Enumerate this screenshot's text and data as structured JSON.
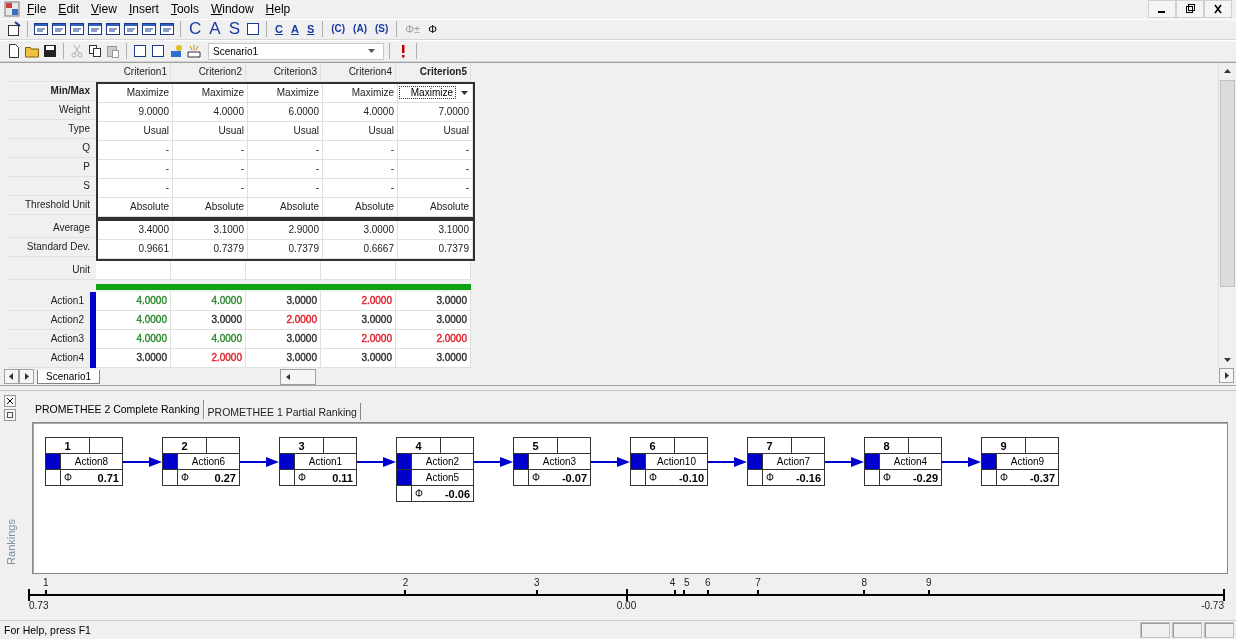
{
  "menu": [
    "File",
    "Edit",
    "View",
    "Insert",
    "Tools",
    "Window",
    "Help"
  ],
  "toolbar_letters": {
    "large": [
      "C",
      "A",
      "S"
    ],
    "underlined": [
      "C",
      "A",
      "S"
    ],
    "bracketed": [
      "(C)",
      "(A)",
      "(S)"
    ],
    "phi": [
      {
        "text": "Φ±",
        "disabled": true
      },
      {
        "text": "Φ",
        "disabled": false
      }
    ]
  },
  "scenario_select": {
    "value": "Scenario1"
  },
  "table": {
    "columns": [
      {
        "name": "Criterion1",
        "selected": false
      },
      {
        "name": "Criterion2",
        "selected": false
      },
      {
        "name": "Criterion3",
        "selected": false
      },
      {
        "name": "Criterion4",
        "selected": false
      },
      {
        "name": "Criterion5",
        "selected": true
      }
    ],
    "parameters": [
      {
        "label": "Min/Max",
        "selected": true,
        "cells": [
          "Maximize",
          "Maximize",
          "Maximize",
          "Maximize",
          "Maximize"
        ]
      },
      {
        "label": "Weight",
        "selected": false,
        "cells": [
          "9.0000",
          "4.0000",
          "6.0000",
          "4.0000",
          "7.0000"
        ]
      },
      {
        "label": "Type",
        "selected": false,
        "cells": [
          "Usual",
          "Usual",
          "Usual",
          "Usual",
          "Usual"
        ]
      },
      {
        "label": "Q",
        "selected": false,
        "cells": [
          "-",
          "-",
          "-",
          "-",
          "-"
        ]
      },
      {
        "label": "P",
        "selected": false,
        "cells": [
          "-",
          "-",
          "-",
          "-",
          "-"
        ]
      },
      {
        "label": "S",
        "selected": false,
        "cells": [
          "-",
          "-",
          "-",
          "-",
          "-"
        ]
      },
      {
        "label": "Threshold Unit",
        "selected": false,
        "cells": [
          "Absolute",
          "Absolute",
          "Absolute",
          "Absolute",
          "Absolute"
        ]
      }
    ],
    "statistics": [
      {
        "label": "Average",
        "cells": [
          "3.4000",
          "3.1000",
          "2.9000",
          "3.0000",
          "3.1000"
        ]
      },
      {
        "label": "Standard Dev.",
        "cells": [
          "0.9661",
          "0.7379",
          "0.7379",
          "0.6667",
          "0.7379"
        ]
      }
    ],
    "unit_row": {
      "label": "Unit"
    },
    "actions": [
      {
        "label": "Action1",
        "color": "#0000cc",
        "cells": [
          {
            "value": "4.0000",
            "color": "#2e8b2e"
          },
          {
            "value": "4.0000",
            "color": "#2e8b2e"
          },
          {
            "value": "3.0000",
            "color": "#333333"
          },
          {
            "value": "2.0000",
            "color": "#e0202c"
          },
          {
            "value": "3.0000",
            "color": "#333333"
          }
        ]
      },
      {
        "label": "Action2",
        "color": "#0000cc",
        "cells": [
          {
            "value": "4.0000",
            "color": "#2e8b2e"
          },
          {
            "value": "3.0000",
            "color": "#333333"
          },
          {
            "value": "2.0000",
            "color": "#e0202c"
          },
          {
            "value": "3.0000",
            "color": "#333333"
          },
          {
            "value": "3.0000",
            "color": "#333333"
          }
        ]
      },
      {
        "label": "Action3",
        "color": "#0000cc",
        "cells": [
          {
            "value": "4.0000",
            "color": "#2e8b2e"
          },
          {
            "value": "4.0000",
            "color": "#2e8b2e"
          },
          {
            "value": "3.0000",
            "color": "#333333"
          },
          {
            "value": "2.0000",
            "color": "#e0202c"
          },
          {
            "value": "2.0000",
            "color": "#e0202c"
          }
        ]
      },
      {
        "label": "Action4",
        "color": "#0000cc",
        "cells": [
          {
            "value": "3.0000",
            "color": "#333333"
          },
          {
            "value": "2.0000",
            "color": "#e0202c"
          },
          {
            "value": "3.0000",
            "color": "#333333"
          },
          {
            "value": "3.0000",
            "color": "#333333"
          },
          {
            "value": "3.0000",
            "color": "#333333"
          }
        ]
      }
    ]
  },
  "sheet_tabs": [
    {
      "label": "Scenario1",
      "selected": true
    }
  ],
  "ranking_tabs": [
    {
      "label": "PROMETHEE 2 Complete Ranking",
      "selected": true
    },
    {
      "label": "PROMETHEE 1 Partial Ranking",
      "selected": false
    }
  ],
  "ranking": [
    {
      "rank": "1",
      "actions": [
        "Action8"
      ],
      "symbol": "Φ",
      "phi": "0.71"
    },
    {
      "rank": "2",
      "actions": [
        "Action6"
      ],
      "symbol": "Φ",
      "phi": "0.27"
    },
    {
      "rank": "3",
      "actions": [
        "Action1"
      ],
      "symbol": "Φ",
      "phi": "0.11"
    },
    {
      "rank": "4",
      "actions": [
        "Action2",
        "Action5"
      ],
      "symbol": "Φ",
      "phi": "-0.06"
    },
    {
      "rank": "5",
      "actions": [
        "Action3"
      ],
      "symbol": "Φ",
      "phi": "-0.07"
    },
    {
      "rank": "6",
      "actions": [
        "Action10"
      ],
      "symbol": "Φ",
      "phi": "-0.10"
    },
    {
      "rank": "7",
      "actions": [
        "Action7"
      ],
      "symbol": "Φ",
      "phi": "-0.16"
    },
    {
      "rank": "8",
      "actions": [
        "Action4"
      ],
      "symbol": "Φ",
      "phi": "-0.29"
    },
    {
      "rank": "9",
      "actions": [
        "Action9"
      ],
      "symbol": "Φ",
      "phi": "-0.37"
    }
  ],
  "side_label": "Rankings",
  "scale": {
    "ticks": [
      {
        "label": "0.73",
        "level": 0
      },
      {
        "label": "0.00",
        "level": 0.5
      },
      {
        "label": "-0.73",
        "level": 1
      }
    ],
    "markers": [
      {
        "label": "1",
        "level": 0.014
      },
      {
        "label": "2",
        "level": 0.315
      },
      {
        "label": "3",
        "level": 0.425
      },
      {
        "label": "4",
        "level": 0.541
      },
      {
        "label": "5",
        "level": 0.548
      },
      {
        "label": "6",
        "level": 0.568
      },
      {
        "label": "7",
        "level": 0.61
      },
      {
        "label": "8",
        "level": 0.699
      },
      {
        "label": "9",
        "level": 0.753
      }
    ]
  },
  "status_bar": "For Help, press F1"
}
